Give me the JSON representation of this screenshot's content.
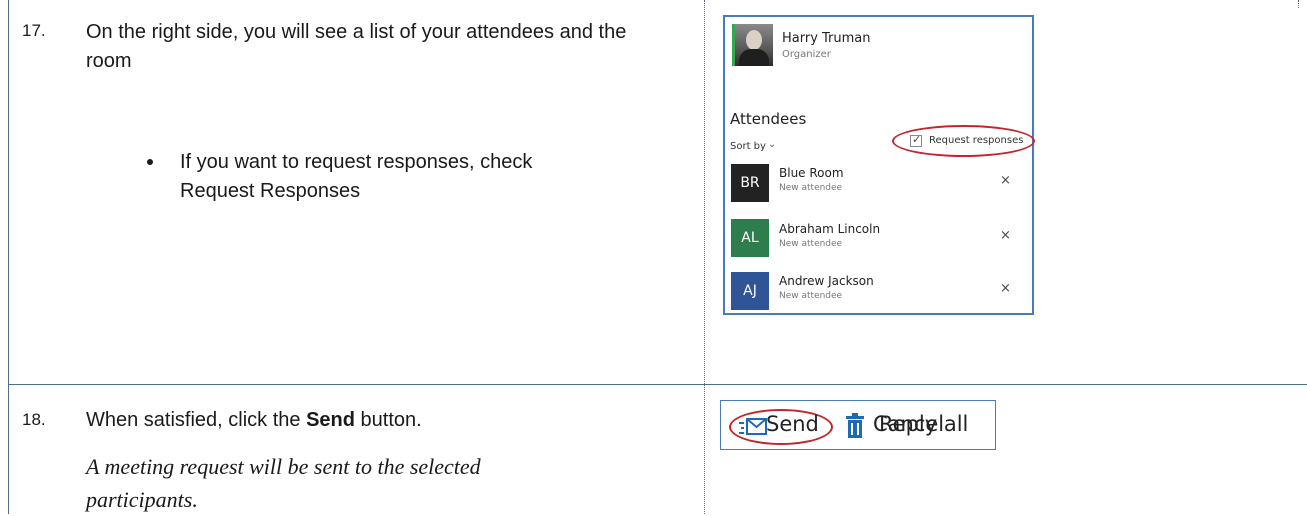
{
  "steps": [
    {
      "number": "17.",
      "text": "On the right side, you will see a list of your attendees and the room",
      "bullet_line1": "If you want to request responses, check",
      "bullet_line2": "Request Responses"
    },
    {
      "number": "18.",
      "text_before": "When satisfied, click the ",
      "text_bold": "Send",
      "text_after": " button.",
      "note_line1": "A meeting request will be sent to the selected",
      "note_line2": "participants."
    }
  ],
  "attendee_panel": {
    "organizer": {
      "name": "Harry Truman",
      "role": "Organizer"
    },
    "section_title": "Attendees",
    "sort_label": "Sort by",
    "request_responses_label": "Request responses",
    "request_responses_checked": true,
    "attendees": [
      {
        "initials": "BR",
        "name": "Blue Room",
        "status": "New attendee",
        "color": "#222222"
      },
      {
        "initials": "AL",
        "name": "Abraham Lincoln",
        "status": "New attendee",
        "color": "#2e7d4f"
      },
      {
        "initials": "AJ",
        "name": "Andrew Jackson",
        "status": "New attendee",
        "color": "#2f5597"
      }
    ]
  },
  "toolbar": {
    "send_label": "Send",
    "cancel_label": "Cancel",
    "reply_all_label": "Reply all",
    "icon_color": "#1f6ab4",
    "highlight_color": "#c0272d"
  }
}
